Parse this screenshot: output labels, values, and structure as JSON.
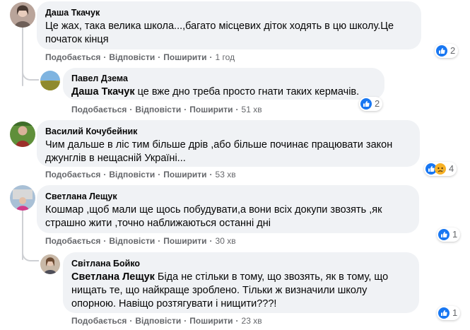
{
  "colors": {
    "bubble": "#f0f2f5",
    "meta": "#65676b",
    "like_blue": "#1877f2",
    "haha_yellow": "#f7b125"
  },
  "actions": {
    "like": "Подобається",
    "reply": "Відповісти",
    "share": "Поширити",
    "separator": "·"
  },
  "comments": [
    {
      "author": "Даша Ткачук",
      "text": "Це жах, така велика школа...,багато місцевих діток ходять в цю школу.Це початок кінця",
      "time": "1 год",
      "reaction_count": "2",
      "reaction_icons": [
        "like-icon"
      ]
    },
    {
      "author": "Павел Дзема",
      "mention": "Даша Ткачук",
      "text": " це вже дно треба просто гнати таких кермачів.",
      "time": "51 хв",
      "reaction_count": "2",
      "reaction_icons": [
        "like-icon"
      ]
    },
    {
      "author": "Василий Кочубейник",
      "text": "Чим дальше в ліс тим більше дрів ,або більше починає працювати закон джунглів в нещасній Україні...",
      "time": "53 хв",
      "reaction_count": "4",
      "reaction_icons": [
        "like-icon",
        "sad-icon"
      ]
    },
    {
      "author": "Светлана Лещук",
      "text": "Кошмар ,щоб мали ще щось побудувати,а вони всіх докупи звозять ,як страшно жити ,точно наближаються останні дні",
      "time": "30 хв",
      "reaction_count": "1",
      "reaction_icons": [
        "like-icon"
      ]
    },
    {
      "author": "Світлана Бойко",
      "mention": "Светлана Лещук",
      "text": " Біда не стільки в тому, що звозять, як в тому, що нищать те, що найкраще зроблено. Тільки ж визначили школу опорною. Навіщо розтягувати і нищити???!",
      "time": "23 хв",
      "reaction_count": "1",
      "reaction_icons": [
        "like-icon"
      ]
    }
  ]
}
